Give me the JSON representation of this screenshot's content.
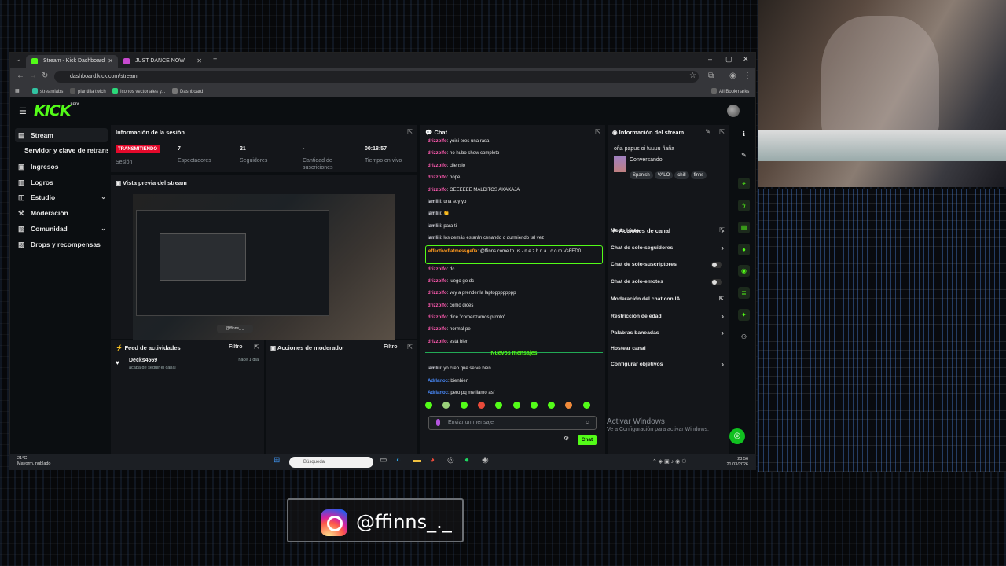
{
  "browser": {
    "tabs": [
      {
        "label": "Stream - Kick Dashboard"
      },
      {
        "label": "JUST DANCE NOW"
      }
    ],
    "url": "dashboard.kick.com/stream",
    "bookmarks": [
      "streamlabs",
      "plantilla twich",
      "Iconos vectoriales y...",
      "Dashboard"
    ],
    "all_bookmarks": "All Bookmarks"
  },
  "sidebar": {
    "items": [
      {
        "label": "Stream"
      },
      {
        "label": "Servidor y clave de retransmisión"
      },
      {
        "label": "Ingresos"
      },
      {
        "label": "Logros"
      },
      {
        "label": "Estudio"
      },
      {
        "label": "Moderación"
      },
      {
        "label": "Comunidad"
      },
      {
        "label": "Drops y recompensas"
      }
    ]
  },
  "session": {
    "title": "Información de la sesión",
    "live": "TRANSMITIENDO",
    "session_label": "Sesión",
    "stats": [
      {
        "value": "7",
        "label": "Espectadores"
      },
      {
        "value": "21",
        "label": "Seguidores"
      },
      {
        "value": "-",
        "label": "Cantidad de suscriciones"
      },
      {
        "value": "00:18:57",
        "label": "Tiempo en vivo"
      }
    ]
  },
  "preview": {
    "title": "Vista previa del stream",
    "ig_tag": "@ffinns_._"
  },
  "feed": {
    "title": "Feed de actividades",
    "filter": "Filtro",
    "item": {
      "name": "Decks4569",
      "sub": "acaba de seguir el canal",
      "time": "hace 1 día"
    }
  },
  "mod": {
    "title": "Acciones de moderador",
    "filter": "Filtro"
  },
  "chat": {
    "title": "Chat",
    "messages": [
      {
        "user": "drizzplfo",
        "color": "#ff5ab0",
        "text": "yoisi eres una rasa"
      },
      {
        "user": "drizzplfo",
        "color": "#ff5ab0",
        "text": "no hubo show completo"
      },
      {
        "user": "drizzplfo",
        "color": "#ff5ab0",
        "text": "cilensio"
      },
      {
        "user": "drizzplfo",
        "color": "#ff5ab0",
        "text": "nope"
      },
      {
        "user": "drizzplfo",
        "color": "#ff5ab0",
        "text": "OEEEEEE MALDITOS AKAKAJA"
      },
      {
        "user": "iamlili",
        "color": "#d8d8e0",
        "text": "una soy yo"
      },
      {
        "user": "iamlili",
        "color": "#d8d8e0",
        "text": "👏"
      },
      {
        "user": "iamlili",
        "color": "#d8d8e0",
        "text": "para ti"
      },
      {
        "user": "iamlili",
        "color": "#d8d8e0",
        "text": "los demás estarán cenando o durmiendo tal vez"
      },
      {
        "user": "effectiveflatmessge0a",
        "color": "#ff9a1f",
        "text": "@ffinns come to us - n e z h n a . c o m VsFED0",
        "highlight": true
      },
      {
        "user": "drizzplfo",
        "color": "#ff5ab0",
        "text": "dc"
      },
      {
        "user": "drizzplfo",
        "color": "#ff5ab0",
        "text": "luego go dc"
      },
      {
        "user": "drizzplfo",
        "color": "#ff5ab0",
        "text": "voy a prender la laptopppppppp"
      },
      {
        "user": "drizzplfo",
        "color": "#ff5ab0",
        "text": "cómo dices"
      },
      {
        "user": "drizzplfo",
        "color": "#ff5ab0",
        "text": "dice \"comenzamos pronto\""
      },
      {
        "user": "drizzplfo",
        "color": "#ff5ab0",
        "text": "normal pe"
      },
      {
        "user": "drizzplfo",
        "color": "#ff5ab0",
        "text": "está bien"
      }
    ],
    "new_label": "Nuevos mensajes",
    "new_messages": [
      {
        "user": "iamlili",
        "color": "#d8d8e0",
        "text": "yo creo que se ve bien"
      },
      {
        "user": "Adrlanoc",
        "color": "#4a8cff",
        "text": "bienbien"
      },
      {
        "user": "Adrlanoc",
        "color": "#4a8cff",
        "text": "pero pq me llamo así"
      }
    ],
    "placeholder": "Enviar un mensaje",
    "send": "Chat"
  },
  "stream_info": {
    "title": "Información del stream",
    "stream_title": "oña papus oi fuuuu ñaña",
    "category": "Conversando",
    "tags": [
      "Spanish",
      "VALO",
      "chill",
      "finns"
    ]
  },
  "channel": {
    "title": "Acciones de canal",
    "items": [
      {
        "label": "Modo lento",
        "ctl": "chevron"
      },
      {
        "label": "Chat de solo-seguidores",
        "ctl": "chevron"
      },
      {
        "label": "Chat de solo-suscriptores",
        "ctl": "toggle"
      },
      {
        "label": "Chat de solo-emotes",
        "ctl": "toggle"
      },
      {
        "label": "Moderación del chat con IA",
        "ctl": "icon"
      },
      {
        "label": "Restricción de edad",
        "ctl": "chevron"
      },
      {
        "label": "Palabras baneadas",
        "ctl": "chevron"
      },
      {
        "label": "Hostear canal",
        "ctl": "none"
      },
      {
        "label": "Configurar objetivos",
        "ctl": "chevron"
      }
    ]
  },
  "windows": {
    "activate": "Activar Windows",
    "activate_sub": "Ve a Configuración para activar Windows.",
    "search": "Búsqueda",
    "weather_temp": "21°C",
    "weather_desc": "Mayorm. nublado",
    "time": "23:56",
    "date": "21/03/2026"
  },
  "overlay": {
    "instagram": "@ffinns_._"
  }
}
